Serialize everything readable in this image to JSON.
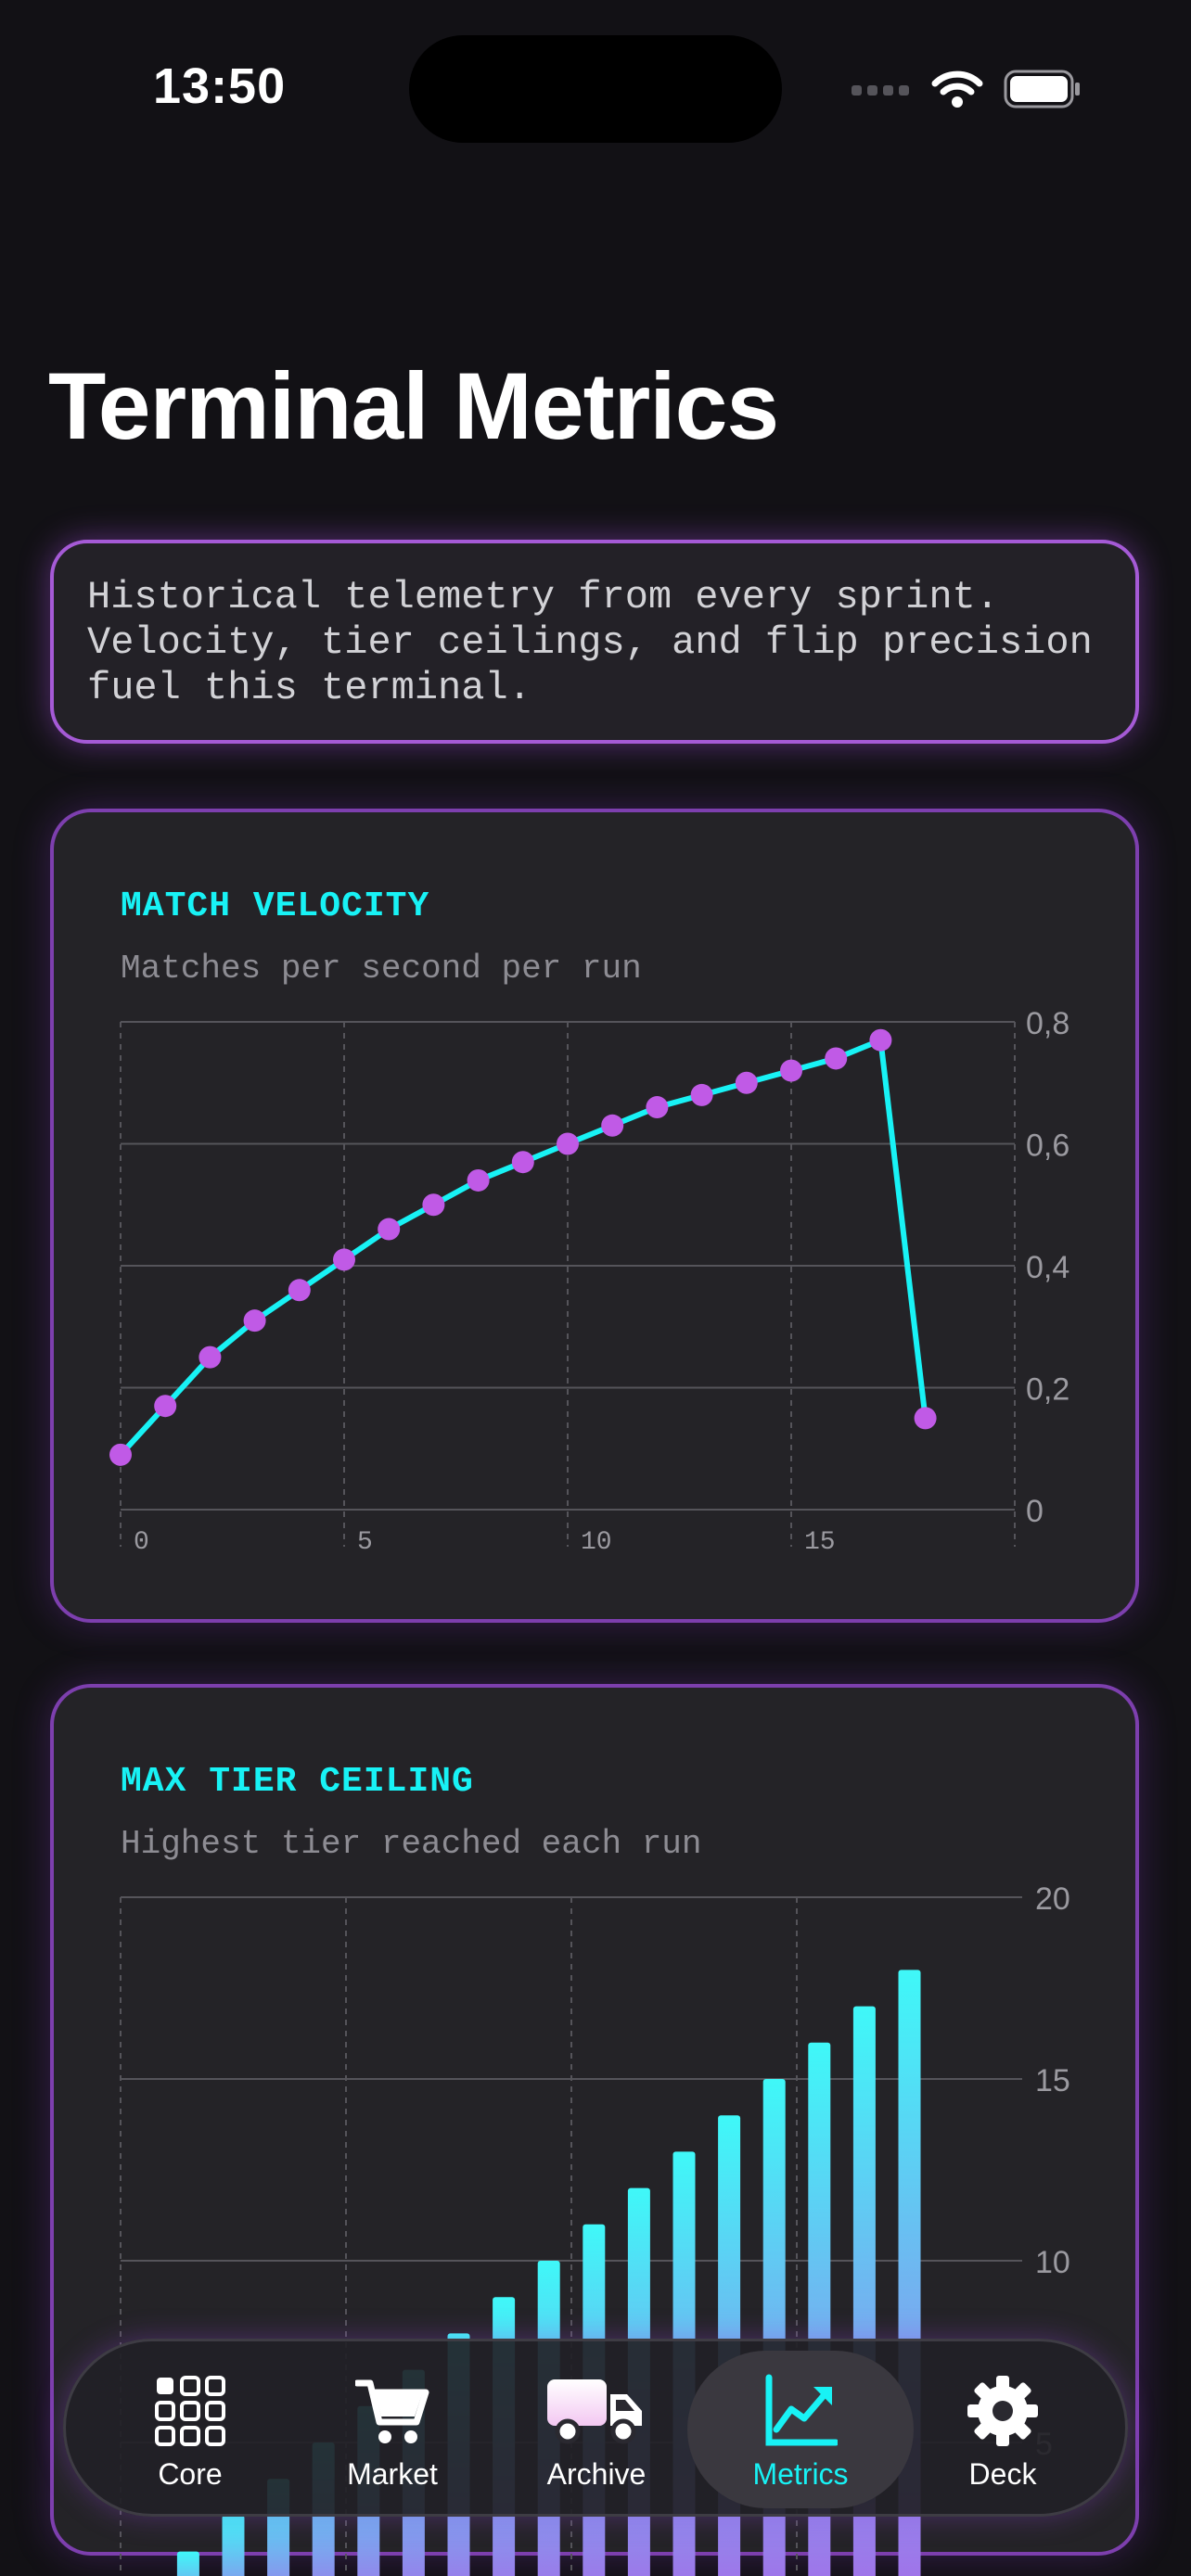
{
  "status_bar": {
    "time": "13:50"
  },
  "page": {
    "title": "Terminal Metrics",
    "intro": "Historical telemetry from every sprint.\nVelocity, tier ceilings, and flip precision\nfuel this terminal."
  },
  "cards": {
    "velocity": {
      "title": "MATCH VELOCITY",
      "subtitle": "Matches per second per run"
    },
    "tier": {
      "title": "MAX TIER CEILING",
      "subtitle": "Highest tier reached each run"
    }
  },
  "chart_data": [
    {
      "type": "line",
      "x": [
        0,
        1,
        2,
        3,
        4,
        5,
        6,
        7,
        8,
        9,
        10,
        11,
        12,
        13,
        14,
        15,
        16,
        17,
        18
      ],
      "y": [
        0.09,
        0.17,
        0.25,
        0.31,
        0.36,
        0.41,
        0.46,
        0.5,
        0.54,
        0.57,
        0.6,
        0.63,
        0.66,
        0.68,
        0.7,
        0.72,
        0.74,
        0.77,
        0.15
      ],
      "xticks": [
        "0",
        "5",
        "10",
        "15"
      ],
      "yticks": [
        "0",
        "0,2",
        "0,4",
        "0,6",
        "0,8"
      ],
      "ylim": [
        0,
        0.8
      ],
      "xlim": [
        0,
        20
      ],
      "colors": {
        "line": "#18f2f5",
        "marker": "#c05ae6"
      },
      "grid": true
    },
    {
      "type": "bar",
      "x": [
        0,
        1,
        2,
        3,
        4,
        5,
        6,
        7,
        8,
        9,
        10,
        11,
        12,
        13,
        14,
        15,
        16,
        17
      ],
      "values": [
        1,
        2,
        3,
        4,
        5,
        6,
        7,
        8,
        9,
        10,
        11,
        12,
        13,
        14,
        15,
        16,
        17,
        18
      ],
      "yticks": [
        "5",
        "10",
        "15",
        "20"
      ],
      "ylim": [
        0,
        20
      ],
      "xlim": [
        0,
        20
      ],
      "colors": {
        "top": "#3ff8f8",
        "bottom": "#a76ae8"
      },
      "grid": true
    }
  ],
  "tabbar": {
    "tabs": [
      {
        "label": "Core",
        "icon": "grid-icon"
      },
      {
        "label": "Market",
        "icon": "cart-icon"
      },
      {
        "label": "Archive",
        "icon": "truck-icon"
      },
      {
        "label": "Metrics",
        "icon": "chart-icon"
      },
      {
        "label": "Deck",
        "icon": "gear-icon"
      }
    ],
    "active": "Metrics",
    "active_color": "#18f2f5"
  }
}
